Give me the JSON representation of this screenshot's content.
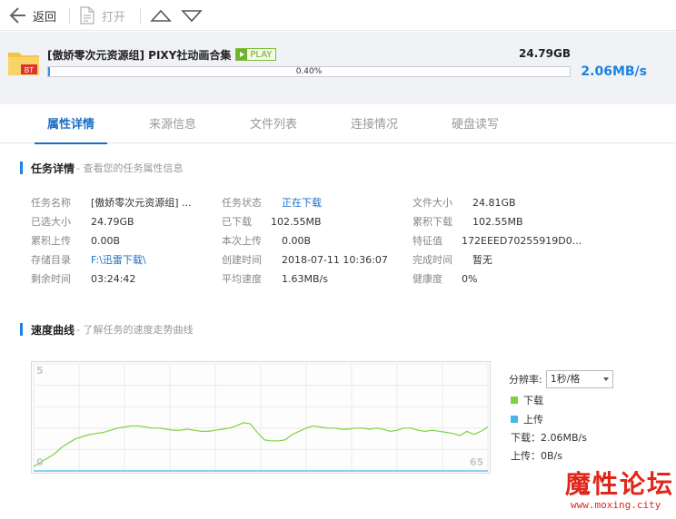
{
  "toolbar": {
    "back_label": "返回",
    "open_label": "打开"
  },
  "task": {
    "name": "[傲娇零次元资源组] PIXY社动画合集",
    "play_label": "PLAY",
    "size": "24.79GB",
    "progress_text": "0.40%",
    "progress_fraction": 0.004,
    "speed": "2.06MB/s",
    "icon_label": "BT"
  },
  "tabs": [
    {
      "label": "属性详情"
    },
    {
      "label": "来源信息"
    },
    {
      "label": "文件列表"
    },
    {
      "label": "连接情况"
    },
    {
      "label": "硬盘读写"
    }
  ],
  "details_section": {
    "title": "任务详情",
    "desc": "- 查看您的任务属性信息"
  },
  "details": {
    "col1": [
      {
        "k": "任务名称",
        "v": "[傲娇零次元资源组] ..."
      },
      {
        "k": "已选大小",
        "v": "24.79GB"
      },
      {
        "k": "累积上传",
        "v": "0.00B"
      },
      {
        "k": "存储目录",
        "v": "F:\\迅雷下载\\"
      },
      {
        "k": "剩余时间",
        "v": "03:24:42"
      }
    ],
    "col2": [
      {
        "k": "任务状态",
        "v": "正在下载"
      },
      {
        "k": "已下载",
        "v": "102.55MB"
      },
      {
        "k": "本次上传",
        "v": "0.00B"
      },
      {
        "k": "创建时间",
        "v": "2018-07-11 10:36:07"
      },
      {
        "k": "平均速度",
        "v": "1.63MB/s"
      }
    ],
    "col3": [
      {
        "k": "文件大小",
        "v": "24.81GB"
      },
      {
        "k": "累积下载",
        "v": "102.55MB"
      },
      {
        "k": "特征值",
        "v": "172EEED70255919D0..."
      },
      {
        "k": "完成时间",
        "v": "暂无"
      },
      {
        "k": "健康度",
        "v": "0%"
      }
    ]
  },
  "speed_section": {
    "title": "速度曲线",
    "desc": "- 了解任务的速度走势曲线"
  },
  "chart_data": {
    "type": "line",
    "y_top_label": "5",
    "y_bottom_label": "0",
    "x_right_label": "65",
    "ylim": [
      0,
      5
    ],
    "x": [
      0,
      1,
      2,
      3,
      4,
      5,
      6,
      7,
      8,
      9,
      10,
      11,
      12,
      13,
      14,
      15,
      16,
      17,
      18,
      19,
      20,
      21,
      22,
      23,
      24,
      25,
      26,
      27,
      28,
      29,
      30,
      31,
      32,
      33,
      34,
      35,
      36,
      37,
      38,
      39,
      40,
      41,
      42,
      43,
      44,
      45,
      46,
      47,
      48,
      49,
      50,
      51,
      52,
      53,
      54,
      55,
      56,
      57,
      58,
      59,
      60,
      61,
      62,
      63,
      64,
      65
    ],
    "series": [
      {
        "name": "下载",
        "color": "#7dd33f",
        "values": [
          0.2,
          0.4,
          0.6,
          0.8,
          1.1,
          1.3,
          1.5,
          1.6,
          1.7,
          1.75,
          1.8,
          1.9,
          2.0,
          2.05,
          2.1,
          2.1,
          2.05,
          2.0,
          2.0,
          1.95,
          1.9,
          1.9,
          1.95,
          1.9,
          1.85,
          1.85,
          1.9,
          1.95,
          2.0,
          2.1,
          2.25,
          2.2,
          1.8,
          1.45,
          1.4,
          1.4,
          1.45,
          1.7,
          1.85,
          2.0,
          2.1,
          2.05,
          2.0,
          2.0,
          1.95,
          1.95,
          2.0,
          2.0,
          1.95,
          2.0,
          1.95,
          1.85,
          1.9,
          2.0,
          2.0,
          1.9,
          1.85,
          1.9,
          1.85,
          1.8,
          1.75,
          1.65,
          1.85,
          1.7,
          1.85,
          2.05
        ]
      },
      {
        "name": "上传",
        "color": "#4ab4e6",
        "values": [
          0,
          0,
          0,
          0,
          0,
          0,
          0,
          0,
          0,
          0,
          0,
          0,
          0,
          0,
          0,
          0,
          0,
          0,
          0,
          0,
          0,
          0,
          0,
          0,
          0,
          0,
          0,
          0,
          0,
          0,
          0,
          0,
          0,
          0,
          0,
          0,
          0,
          0,
          0,
          0,
          0,
          0,
          0,
          0,
          0,
          0,
          0,
          0,
          0,
          0,
          0,
          0,
          0,
          0,
          0,
          0,
          0,
          0,
          0,
          0,
          0,
          0,
          0,
          0,
          0,
          0
        ]
      }
    ]
  },
  "legend": {
    "resolution_label": "分辨率:",
    "resolution_value": "1秒/格",
    "download_label": "下载",
    "upload_label": "上传",
    "download_speed": "下载：2.06MB/s",
    "upload_speed": "上传：0B/s"
  },
  "watermark": {
    "cn": "魔性论坛",
    "url": "www.moxing.city"
  }
}
